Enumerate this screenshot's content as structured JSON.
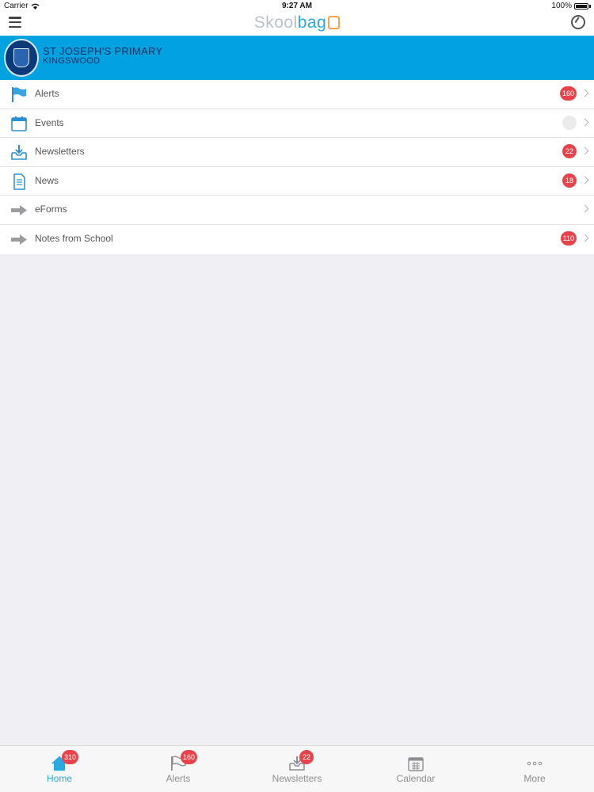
{
  "status_bar": {
    "carrier": "Carrier",
    "time": "9:27 AM",
    "battery": "100%"
  },
  "nav": {
    "logo_part1": "Skool",
    "logo_part2": "bag",
    "menu_icon": "hamburger-icon",
    "sync_icon": "sync-icon"
  },
  "school": {
    "name_line1": "ST JOSEPH'S PRIMARY",
    "name_line2": "KINGSWOOD",
    "crest_icon": "school-crest"
  },
  "menu": [
    {
      "label": "Alerts",
      "icon": "flag-icon",
      "badge": "160"
    },
    {
      "label": "Events",
      "icon": "calendar-icon",
      "badge": ""
    },
    {
      "label": "Newsletters",
      "icon": "inbox-download-icon",
      "badge": "22"
    },
    {
      "label": "News",
      "icon": "document-icon",
      "badge": "18"
    },
    {
      "label": "eForms",
      "icon": "arrow-right-icon",
      "badge": ""
    },
    {
      "label": "Notes from School",
      "icon": "arrow-right-icon",
      "badge": "110"
    }
  ],
  "tabs": [
    {
      "label": "Home",
      "icon": "home-icon",
      "badge": "310",
      "active": true
    },
    {
      "label": "Alerts",
      "icon": "flag-icon",
      "badge": "160",
      "active": false
    },
    {
      "label": "Newsletters",
      "icon": "inbox-download-icon",
      "badge": "22",
      "active": false
    },
    {
      "label": "Calendar",
      "icon": "calendar-icon",
      "badge": "",
      "active": false
    },
    {
      "label": "More",
      "icon": "more-dots-icon",
      "badge": "",
      "active": false
    }
  ],
  "colors": {
    "accent": "#29a9e1",
    "banner": "#00a3e0",
    "badge": "#e8434a"
  }
}
